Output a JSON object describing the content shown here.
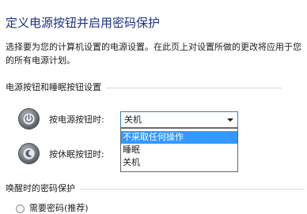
{
  "page": {
    "title": "定义电源按钮并启用密码保护",
    "description": "选择要为您的计算机设置的电源设置。在此页上对设置所做的更改将应用于您的所有电源计划。"
  },
  "power_section": {
    "header": "电源按钮和睡眠按钮设置",
    "power_button_label": "按电源按钮时:",
    "sleep_button_label": "按休眠按钮时:",
    "power_button_selected": "关机",
    "dropdown_options": [
      "不采取任何操作",
      "睡眠",
      "关机"
    ],
    "highlighted_option": "不采取任何操作"
  },
  "wake_section": {
    "header": "唤醒时的密码保护",
    "require_password_label": "需要密码(推荐)"
  },
  "colors": {
    "title": "#1e3287",
    "highlight": "#3399ff",
    "combo_border": "#3c7fb1"
  },
  "icons": [
    "power-icon",
    "sleep-icon",
    "chevron-down-icon"
  ]
}
